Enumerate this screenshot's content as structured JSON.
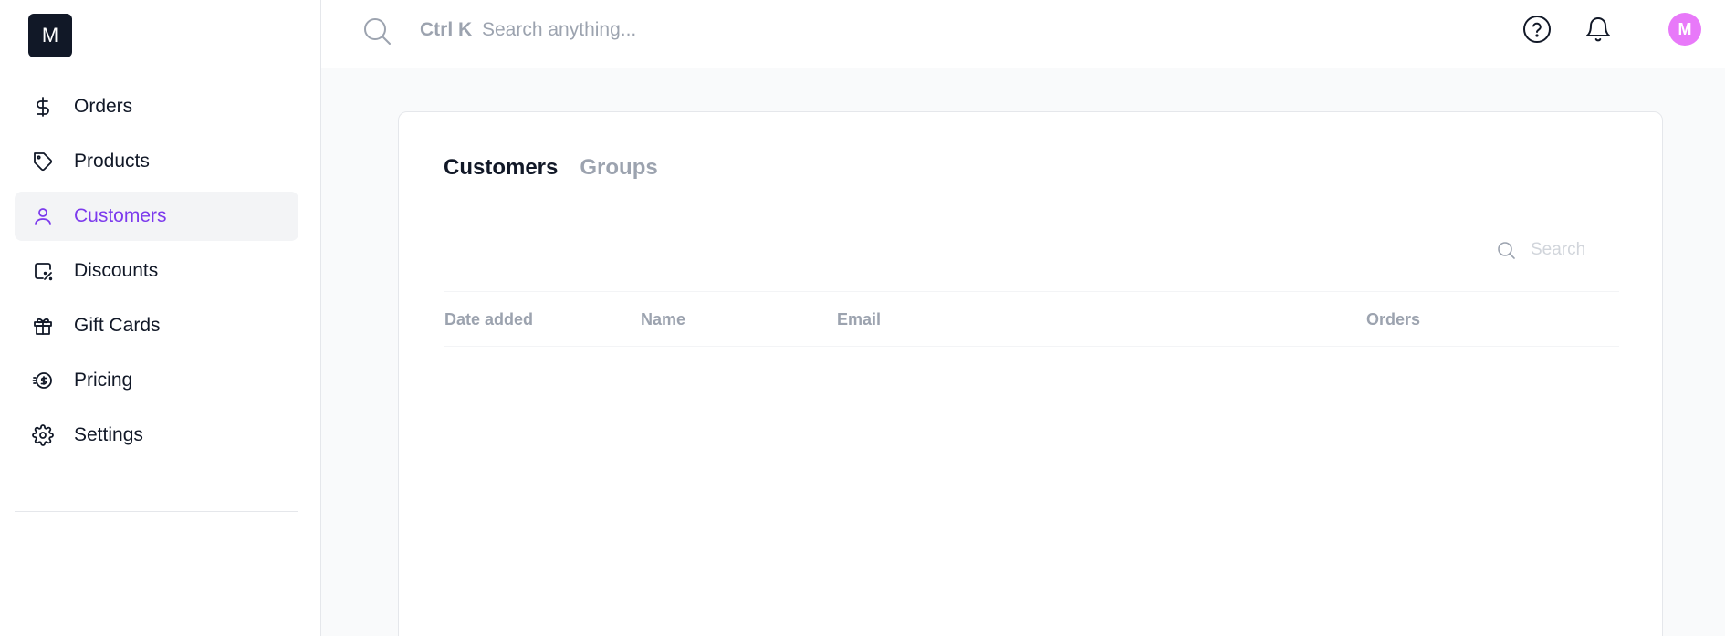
{
  "sidebar": {
    "logo_letter": "M",
    "items": [
      {
        "label": "Orders",
        "icon": "dollar-icon"
      },
      {
        "label": "Products",
        "icon": "tag-icon"
      },
      {
        "label": "Customers",
        "icon": "user-icon",
        "active": true
      },
      {
        "label": "Discounts",
        "icon": "discount-icon"
      },
      {
        "label": "Gift Cards",
        "icon": "gift-icon"
      },
      {
        "label": "Pricing",
        "icon": "pricing-icon"
      },
      {
        "label": "Settings",
        "icon": "gear-icon"
      }
    ]
  },
  "topbar": {
    "shortcut": "Ctrl K",
    "search_placeholder": "Search anything...",
    "search_value": "",
    "avatar_letter": "M",
    "avatar_color": "#e879f9"
  },
  "main": {
    "tabs": [
      {
        "label": "Customers",
        "active": true
      },
      {
        "label": "Groups",
        "active": false
      }
    ],
    "search_placeholder": "Search",
    "columns": [
      "Date added",
      "Name",
      "Email",
      "Orders"
    ],
    "rows": []
  },
  "colors": {
    "accent": "#7c3aed",
    "muted": "#9ca3af",
    "text": "#111827"
  }
}
